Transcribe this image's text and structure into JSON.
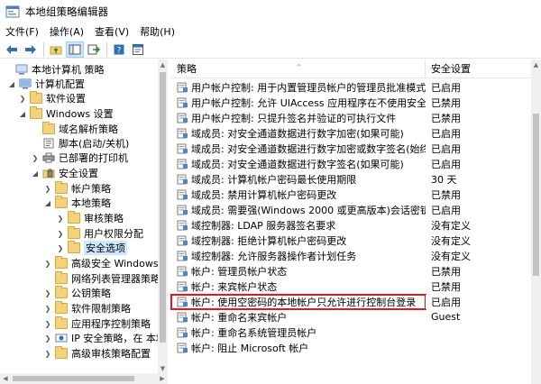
{
  "window": {
    "title": "本地组策略编辑器"
  },
  "menu": [
    {
      "label": "文件(F)"
    },
    {
      "label": "操作(A)"
    },
    {
      "label": "查看(V)"
    },
    {
      "label": "帮助(H)"
    }
  ],
  "toolbar": {
    "buttons": [
      "back-icon",
      "forward-icon",
      "up-folder-icon",
      "show-tree-icon",
      "export-list-icon",
      "help-icon",
      "properties-icon"
    ]
  },
  "tree": [
    {
      "label": "本地计算机 策略",
      "icon": "computer-policy-icon",
      "expander": ""
    },
    {
      "label": "计算机配置",
      "icon": "computer-icon",
      "expander": "down"
    },
    {
      "label": "软件设置",
      "icon": "folder-icon",
      "expander": "right"
    },
    {
      "label": "Windows 设置",
      "icon": "folder-icon",
      "expander": "down"
    },
    {
      "label": "域名解析策略",
      "icon": "folder-icon",
      "expander": ""
    },
    {
      "label": "脚本(启动/关机)",
      "icon": "script-icon",
      "expander": ""
    },
    {
      "label": "已部署的打印机",
      "icon": "printer-icon",
      "expander": "right"
    },
    {
      "label": "安全设置",
      "icon": "security-icon",
      "expander": "down"
    },
    {
      "label": "帐户策略",
      "icon": "folder-icon",
      "expander": "right"
    },
    {
      "label": "本地策略",
      "icon": "folder-icon",
      "expander": "down"
    },
    {
      "label": "审核策略",
      "icon": "folder-icon",
      "expander": "right"
    },
    {
      "label": "用户权限分配",
      "icon": "folder-icon",
      "expander": "right"
    },
    {
      "label": "安全选项",
      "icon": "folder-icon",
      "expander": "right",
      "selected": true
    },
    {
      "label": "高级安全 Windows D",
      "icon": "folder-icon",
      "expander": "right"
    },
    {
      "label": "网络列表管理器策略",
      "icon": "folder-icon",
      "expander": ""
    },
    {
      "label": "公钥策略",
      "icon": "folder-icon",
      "expander": "right"
    },
    {
      "label": "软件限制策略",
      "icon": "folder-icon",
      "expander": "right"
    },
    {
      "label": "应用程序控制策略",
      "icon": "folder-icon",
      "expander": "right"
    },
    {
      "label": "IP 安全策略，在 本地",
      "icon": "ip-security-icon",
      "expander": "right"
    },
    {
      "label": "高级审核策略配置",
      "icon": "folder-icon",
      "expander": "right"
    }
  ],
  "list": {
    "headers": {
      "policy": "策略",
      "setting": "安全设置"
    },
    "rows": [
      {
        "policy": "用户帐户控制: 用于内置管理员帐户的管理员批准模式",
        "setting": "已启用"
      },
      {
        "policy": "用户帐户控制: 允许 UIAccess 应用程序在不使用安全桌面...",
        "setting": "已禁用"
      },
      {
        "policy": "用户帐户控制: 只提升签名并验证的可执行文件",
        "setting": "已禁用"
      },
      {
        "policy": "域成员: 对安全通道数据进行数字加密(如果可能)",
        "setting": "已启用"
      },
      {
        "policy": "域成员: 对安全通道数据进行数字加密或数字签名(始终)",
        "setting": "已启用"
      },
      {
        "policy": "域成员: 对安全通道数据进行数字签名(如果可能)",
        "setting": "已启用"
      },
      {
        "policy": "域成员: 计算机帐户密码最长使用期限",
        "setting": "30 天"
      },
      {
        "policy": "域成员: 禁用计算机帐户密码更改",
        "setting": "已禁用"
      },
      {
        "policy": "域成员: 需要强(Windows 2000 或更高版本)会话密钥",
        "setting": "已启用"
      },
      {
        "policy": "域控制器: LDAP 服务器签名要求",
        "setting": "没有定义"
      },
      {
        "policy": "域控制器: 拒绝计算机帐户密码更改",
        "setting": "没有定义"
      },
      {
        "policy": "域控制器: 允许服务器操作者计划任务",
        "setting": "没有定义"
      },
      {
        "policy": "帐户: 管理员帐户状态",
        "setting": "已禁用"
      },
      {
        "policy": "帐户: 来宾帐户状态",
        "setting": "已禁用"
      },
      {
        "policy": "帐户: 使用空密码的本地帐户只允许进行控制台登录",
        "setting": "已启用",
        "highlight": true
      },
      {
        "policy": "帐户: 重命名来宾帐户",
        "setting": "Guest"
      },
      {
        "policy": "帐户: 重命名系统管理员帐户",
        "setting": ""
      },
      {
        "policy": "帐户: 阻止 Microsoft 帐户",
        "setting": ""
      }
    ]
  },
  "colors": {
    "selection": "#cce8ff",
    "highlight_box": "#e0191b"
  }
}
